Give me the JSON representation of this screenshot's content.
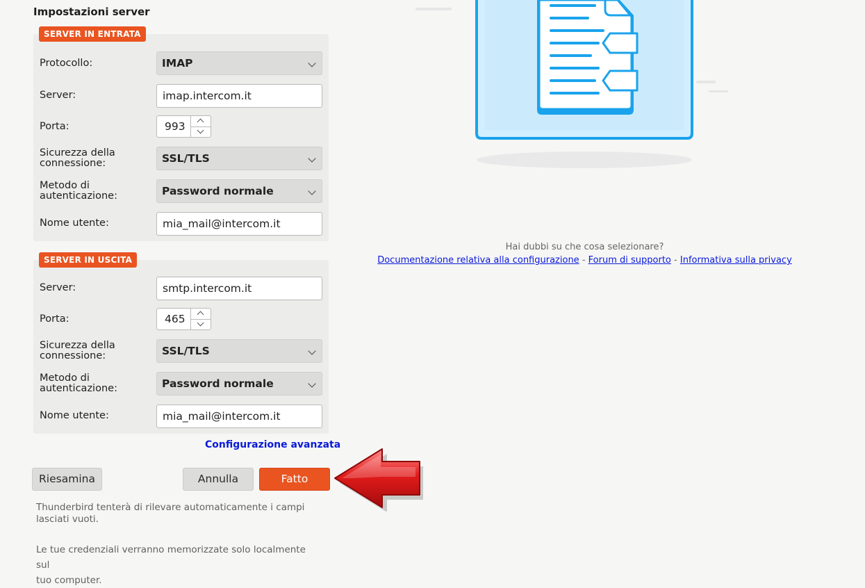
{
  "section_title": "Impostazioni server",
  "incoming": {
    "badge": "SERVER IN ENTRATA",
    "protocol_label": "Protocollo:",
    "protocol_value": "IMAP",
    "server_label": "Server:",
    "server_value": "imap.intercom.it",
    "port_label": "Porta:",
    "port_value": "993",
    "security_label_1": "Sicurezza della",
    "security_label_2": "connessione:",
    "security_value": "SSL/TLS",
    "auth_label_1": "Metodo di",
    "auth_label_2": "autenticazione:",
    "auth_value": "Password normale",
    "username_label": "Nome utente:",
    "username_value": "mia_mail@intercom.it"
  },
  "outgoing": {
    "badge": "SERVER IN USCITA",
    "server_label": "Server:",
    "server_value": "smtp.intercom.it",
    "port_label": "Porta:",
    "port_value": "465",
    "security_label_1": "Sicurezza della",
    "security_label_2": "connessione:",
    "security_value": "SSL/TLS",
    "auth_label_1": "Metodo di",
    "auth_label_2": "autenticazione:",
    "auth_value": "Password normale",
    "username_label": "Nome utente:",
    "username_value": "mia_mail@intercom.it"
  },
  "advanced_link": "Configurazione avanzata",
  "buttons": {
    "review": "Riesamina",
    "cancel": "Annulla",
    "done": "Fatto"
  },
  "notes": {
    "autodetect_1": "Thunderbird tenterà di rilevare automaticamente i campi",
    "autodetect_2": "lasciati vuoti.",
    "credentials_1": "Le tue credenziali verranno memorizzate solo localmente sul",
    "credentials_2": "tuo computer."
  },
  "help": {
    "question": "Hai dubbi su che cosa selezionare?",
    "link_docs": "Documentazione relativa alla configurazione",
    "link_forum": "Forum di supporto",
    "link_privacy": "Informativa sulla privacy",
    "separator": "-"
  },
  "colors": {
    "accent": "#e95420",
    "link": "#0a1ad8",
    "illustration_blue": "#1aa3ec",
    "illustration_fill": "#d2efff",
    "arrow_red": "#d81a1a"
  },
  "icons": {
    "illustration": "document-illustration",
    "arrow": "red-left-arrow"
  }
}
